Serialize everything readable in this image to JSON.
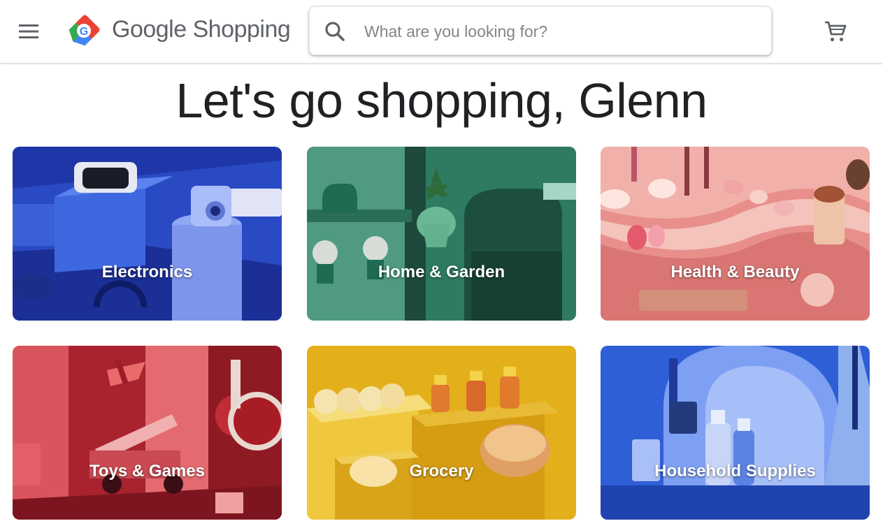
{
  "header": {
    "brand_google": "Google",
    "brand_shopping": "Shopping",
    "search_placeholder": "What are you looking for?",
    "menu_icon": "hamburger-menu-icon",
    "cart_icon": "shopping-cart-icon",
    "logo_icon": "google-shopping-tag-logo"
  },
  "greeting": "Let's go shopping, Glenn",
  "categories": [
    {
      "label": "Electronics",
      "color": "#2744b8"
    },
    {
      "label": "Home & Garden",
      "color": "#2f7a63"
    },
    {
      "label": "Health & Beauty",
      "color": "#e8a0a0"
    },
    {
      "label": "Toys & Games",
      "color": "#b32a36"
    },
    {
      "label": "Grocery",
      "color": "#e0b21e"
    },
    {
      "label": "Household Supplies",
      "color": "#2a57c8"
    }
  ],
  "colors": {
    "text_primary": "#202124",
    "text_secondary": "#5f6368",
    "google_blue": "#4285f4",
    "google_red": "#ea4335",
    "google_yellow": "#fbbc04",
    "google_green": "#34a853"
  }
}
